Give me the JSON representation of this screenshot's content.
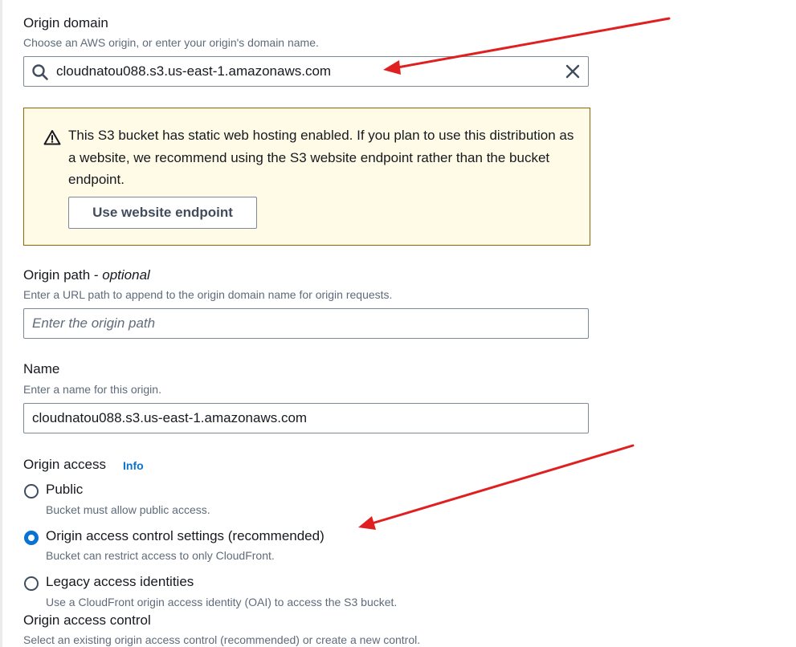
{
  "origin_domain": {
    "label": "Origin domain",
    "description": "Choose an AWS origin, or enter your origin's domain name.",
    "value": "cloudnatou088.s3.us-east-1.amazonaws.com"
  },
  "alert": {
    "message": "This S3 bucket has static web hosting enabled. If you plan to use this distribution as a website, we recommend using the S3 website endpoint rather than the bucket endpoint.",
    "button_label": "Use website endpoint"
  },
  "origin_path": {
    "label": "Origin path - ",
    "label_optional": "optional",
    "description": "Enter a URL path to append to the origin domain name for origin requests.",
    "placeholder": "Enter the origin path"
  },
  "name": {
    "label": "Name",
    "description": "Enter a name for this origin.",
    "value": "cloudnatou088.s3.us-east-1.amazonaws.com"
  },
  "origin_access": {
    "label": "Origin access",
    "info_link": "Info",
    "options": [
      {
        "label": "Public",
        "description": "Bucket must allow public access.",
        "selected": false
      },
      {
        "label": "Origin access control settings (recommended)",
        "description": "Bucket can restrict access to only CloudFront.",
        "selected": true
      },
      {
        "label": "Legacy access identities",
        "description": "Use a CloudFront origin access identity (OAI) to access the S3 bucket.",
        "selected": false
      }
    ]
  },
  "origin_access_control": {
    "label": "Origin access control",
    "description": "Select an existing origin access control (recommended) or create a new control."
  },
  "colors": {
    "accent": "#0972d3",
    "warning_bg": "#fffbe6",
    "warning_border": "#8d6605",
    "annotation_arrow": "#e02020"
  }
}
